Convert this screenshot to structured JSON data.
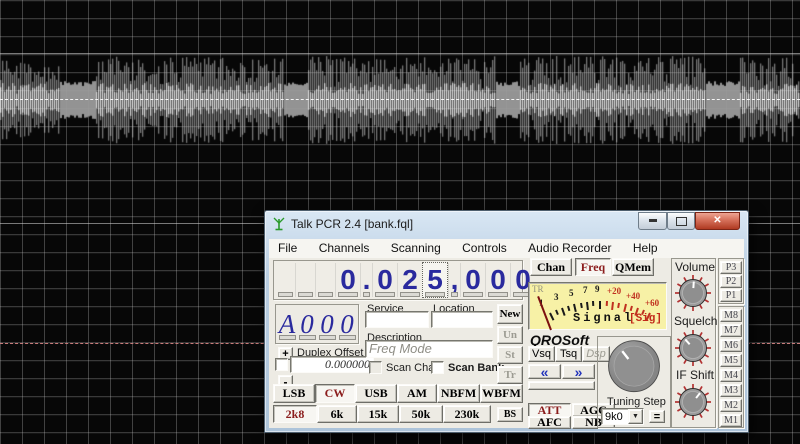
{
  "window": {
    "title": "Talk PCR 2.4 [bank.fql]",
    "menu": [
      "File",
      "Channels",
      "Scanning",
      "Controls",
      "Audio Recorder",
      "Help"
    ]
  },
  "icons": {
    "app": "antenna-icon",
    "minimize": "–",
    "maximize": "▢",
    "close": "✕",
    "prev": "«",
    "next": "»",
    "dropdown_arrow": "▼"
  },
  "frequency": {
    "value": "0.025,000",
    "cells": [
      "",
      "",
      "",
      "0",
      ".",
      "0",
      "2",
      "5",
      ",",
      "0",
      "0",
      "0"
    ],
    "focused_cell": 7
  },
  "channel": {
    "value": "A000",
    "chars": [
      "A",
      "0",
      "0",
      "0"
    ]
  },
  "duplex": {
    "plus": "+",
    "minus": "-",
    "label": "Duplex Offset",
    "value": "0.000000"
  },
  "info": {
    "service_label": "Service",
    "service_value": "",
    "location_label": "Location",
    "location_value": "",
    "description_label": "Description",
    "description_value": "Freq Mode",
    "scan_chan": "Scan Chan",
    "scan_bank": "Scan Bank"
  },
  "actions": {
    "new": "New",
    "un": "Un",
    "st": "St",
    "tr": "Tr"
  },
  "modes": {
    "items": [
      "LSB",
      "CW",
      "USB",
      "AM",
      "NBFM",
      "WBFM"
    ],
    "active": "CW"
  },
  "filters": {
    "items": [
      "2k8",
      "6k",
      "15k",
      "50k",
      "230k"
    ],
    "bs": "BS",
    "active": "2k8"
  },
  "display_tabs": {
    "items": [
      "Chan",
      "Freq",
      "QMem"
    ],
    "active": "Freq"
  },
  "meter": {
    "corner": "TR",
    "scale": [
      "1",
      "3",
      "5",
      "7",
      "9",
      "+20",
      "+40",
      "+60"
    ],
    "label": "Signal",
    "sub": "[Sig]",
    "bg_color": "#f7f1a6",
    "red_color": "#c03020"
  },
  "brand": "QROSoft",
  "squelch_tabs": {
    "items": [
      "Vsq",
      "Tsq",
      "Dsp"
    ],
    "disabled": "Dsp"
  },
  "dsp": {
    "items": [
      "ATT",
      "AGC",
      "AFC",
      "NB"
    ],
    "active": "ATT"
  },
  "tuning": {
    "label": "Tuning Step",
    "step_value": "9k0",
    "equals_label": "="
  },
  "knobs": {
    "volume": "Volume",
    "squelch": "Squelch",
    "if_shift": "IF Shift"
  },
  "presets": [
    "P3",
    "P2",
    "P1"
  ],
  "memories": [
    "M8",
    "M7",
    "M6",
    "M5",
    "M4",
    "M3",
    "M2",
    "M1"
  ],
  "colors": {
    "accent_red": "#8b1d1d",
    "digit_navy": "#2a2a9e",
    "title_close": "#b03a22"
  }
}
